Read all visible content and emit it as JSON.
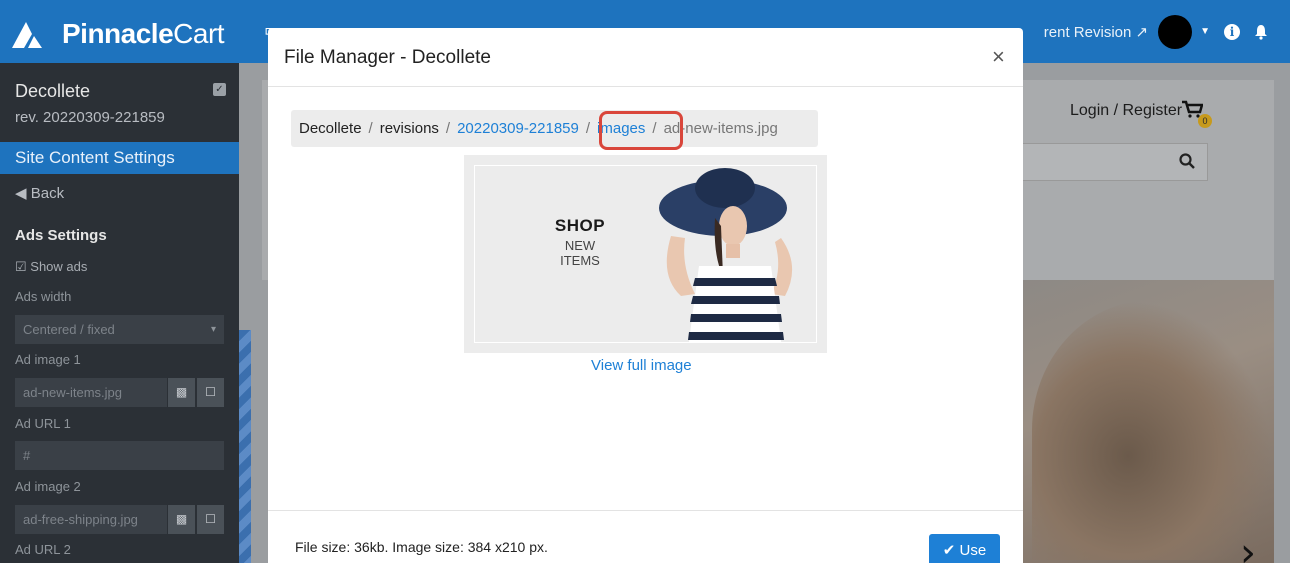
{
  "topbar": {
    "logo_bold": "Pinnacle",
    "logo_light": "Cart",
    "revision_link": "rent Revision",
    "external_icon": "external-link-icon",
    "info_icon": "i"
  },
  "sidebar": {
    "site_name": "Decollete",
    "revision": "rev. 20220309-221859",
    "section_title": "Site Content Settings",
    "back_label": "Back",
    "ads_heading": "Ads Settings",
    "show_ads_label": "Show ads",
    "ads_width_label": "Ads width",
    "ads_width_value": "Centered / fixed",
    "ad_image_1_label": "Ad image 1",
    "ad_image_1_value": "ad-new-items.jpg",
    "ad_url_1_label": "Ad URL 1",
    "ad_url_1_value": "#",
    "ad_image_2_label": "Ad image 2",
    "ad_image_2_value": "ad-free-shipping.jpg",
    "ad_url_2_label": "Ad URL 2"
  },
  "storefront": {
    "login_register": "Login / Register",
    "cart_count": "0"
  },
  "modal": {
    "title": "File Manager - Decollete",
    "close_symbol": "×",
    "breadcrumb": {
      "root": "Decollete",
      "sep": "/",
      "revisions": "revisions",
      "revision_id": "20220309-221859",
      "images": "images",
      "file": "ad-new-items.jpg"
    },
    "preview": {
      "shop_title": "SHOP",
      "shop_subtitle": "NEW ITEMS"
    },
    "view_full_image": "View full image",
    "file_info": "File size: 36kb. Image size: 384 x210 px.",
    "use_button": "Use"
  },
  "colors": {
    "brand_blue": "#1e73be",
    "link_blue": "#1e80d6",
    "highlight_red": "#d9463b"
  }
}
